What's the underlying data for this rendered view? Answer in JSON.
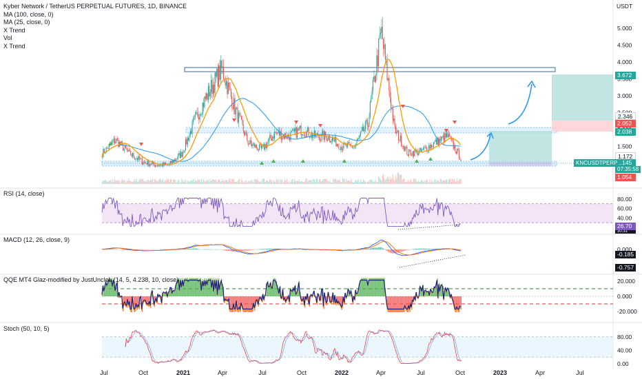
{
  "header": {
    "title": "Kyber Network / TetherUS PERPETUAL FUTURES, 1D, BINANCE",
    "indicators": [
      "MA (100, close, 0)",
      "MA (25, close, 0)",
      "X Trend",
      "Vol",
      "X Trend"
    ]
  },
  "price_axis": {
    "unit": "USDT",
    "ticks": [
      "5.000",
      "4.500",
      "4.000",
      "3.500",
      "3.000",
      "2.500",
      "2.000",
      "1.500",
      "1.000"
    ]
  },
  "tags": {
    "tp2": "3.672",
    "t_a": "2.346",
    "t_b": "2.052",
    "t_c": "2.038",
    "t_d": "1.172",
    "last": "1.145",
    "stop": "1.054",
    "symbol": "KNCUSDTPERP",
    "countdown": "07:35:58"
  },
  "panes": {
    "rsi": {
      "title": "RSI (14, close)",
      "ticks": [
        "80.00",
        "60.00",
        "40.00"
      ],
      "value": "26.70",
      "value2": "30.31"
    },
    "macd": {
      "title": "MACD (12, 26, close, 9)",
      "ticks": [
        "0.000"
      ],
      "value1": "-0.185",
      "value2": "-0.757"
    },
    "qqe": {
      "title": "QQE MT4 Glaz-modified by JustUncleL (14, 5, 4.238, 10, close)",
      "ticks": [
        "20.000",
        "0.000",
        "-20.000"
      ]
    },
    "stoch": {
      "title": "Stoch (50, 10, 5)",
      "ticks": [
        "80.00",
        "40.00",
        "0.00"
      ]
    }
  },
  "time_axis": [
    "Jul",
    "Oct",
    "2021",
    "Apr",
    "Jul",
    "Oct",
    "2022",
    "Apr",
    "Jul",
    "Oct",
    "2023",
    "Apr",
    "Jul"
  ],
  "colors": {
    "up": "#26a69a",
    "down": "#ef5350",
    "ma100": "#2196f3",
    "ma25": "#ff9800",
    "rsi": "#7e57c2",
    "band": "#e1bee7",
    "target_zone": "#b2dfdb",
    "stop_zone": "#ffcdd2",
    "arrow": "#2196f3"
  },
  "chart_data": {
    "type": "candlestick",
    "x": [
      "2020-07",
      "2020-08",
      "2020-09",
      "2020-10",
      "2020-11",
      "2020-12",
      "2021-01",
      "2021-02",
      "2021-03",
      "2021-04",
      "2021-05",
      "2021-06",
      "2021-07",
      "2021-08",
      "2021-09",
      "2021-10",
      "2021-11",
      "2021-12",
      "2022-01",
      "2022-02",
      "2022-03",
      "2022-04",
      "2022-05",
      "2022-06",
      "2022-07",
      "2022-08",
      "2022-09",
      "2022-10"
    ],
    "close": [
      1.3,
      1.7,
      1.3,
      1.05,
      0.95,
      0.95,
      1.3,
      2.3,
      3.1,
      3.8,
      2.6,
      1.6,
      1.4,
      1.9,
      1.8,
      2.0,
      1.8,
      1.8,
      1.5,
      1.5,
      2.2,
      4.9,
      2.0,
      1.3,
      1.35,
      1.6,
      1.8,
      1.145
    ],
    "ylim": [
      0.9,
      5.2
    ],
    "resistance_lines": [
      3.85,
      3.8
    ],
    "zones": [
      {
        "from": 2.0,
        "to": 2.1
      },
      {
        "from": 1.1,
        "to": 1.15
      }
    ],
    "targets": {
      "tp1": 2.038,
      "tp2": 3.672,
      "entry": 1.145,
      "stop": 1.054
    },
    "rsi": {
      "ylim": [
        20,
        90
      ],
      "bands": [
        30,
        70
      ],
      "last": 26.7
    },
    "macd": {
      "last": -0.185,
      "signal": -0.757
    },
    "stoch": {
      "ylim": [
        0,
        100
      ],
      "bands": [
        20,
        80
      ]
    }
  }
}
